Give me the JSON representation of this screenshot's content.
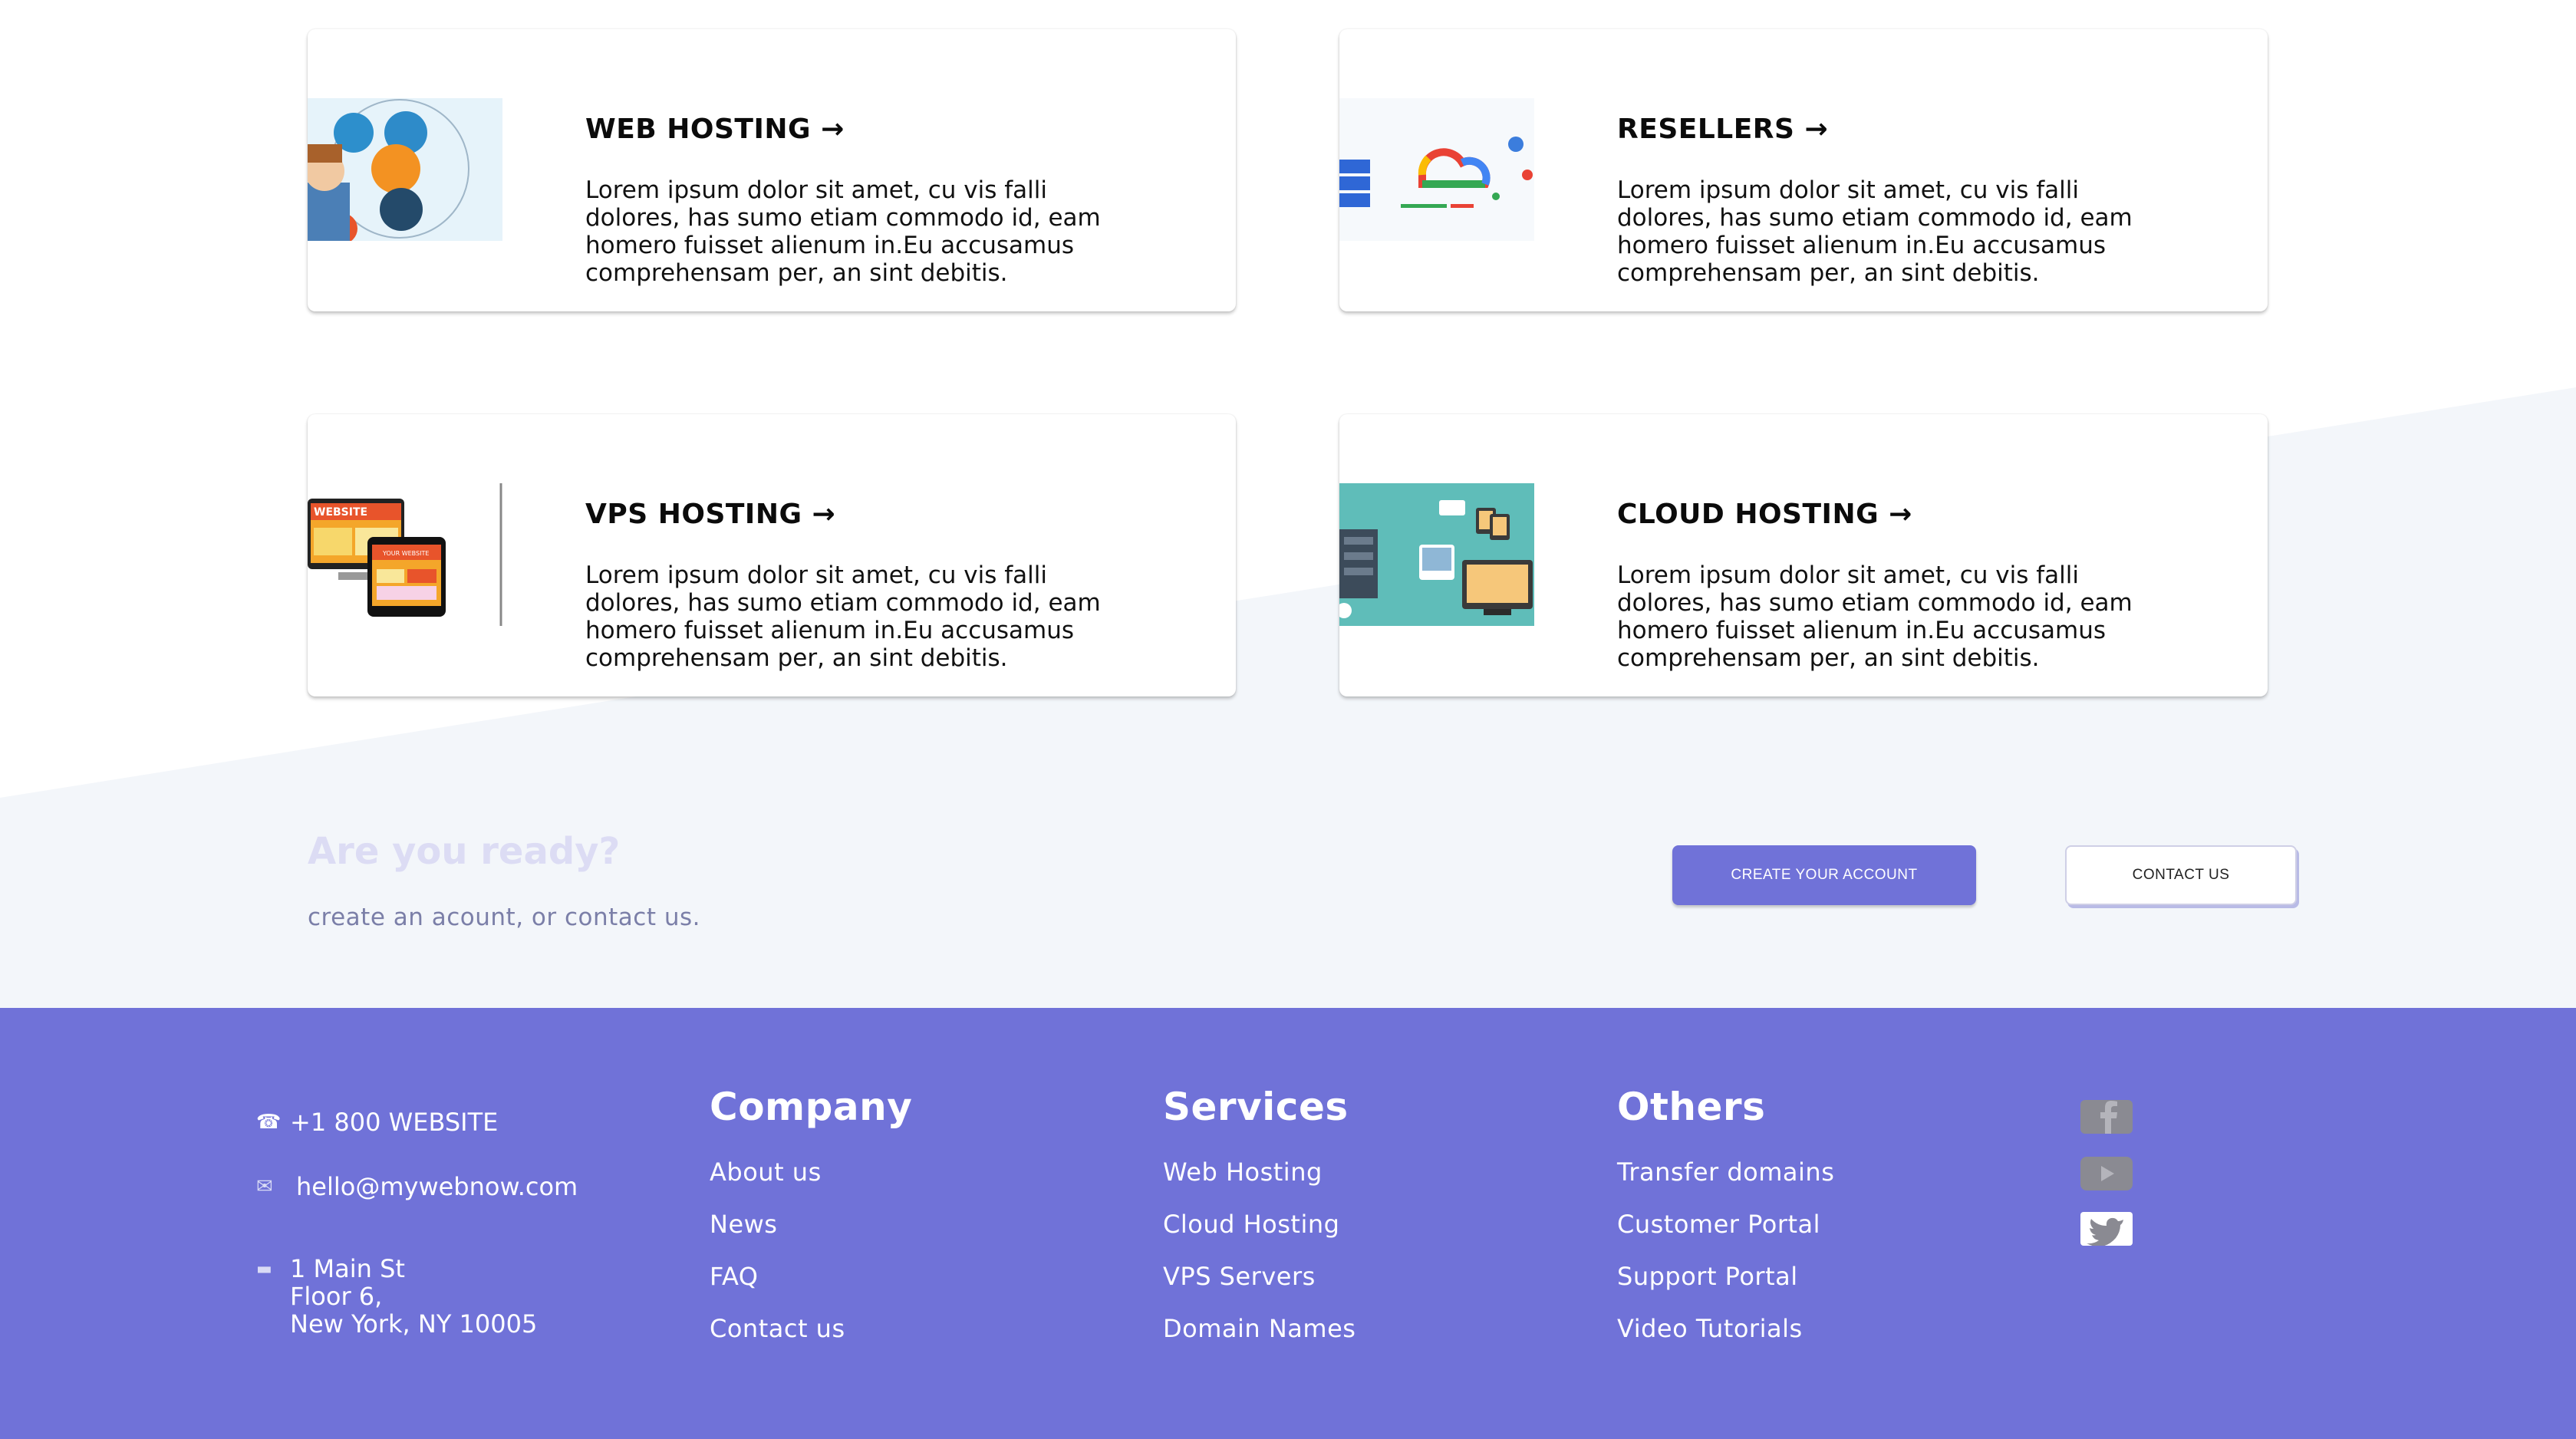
{
  "colors": {
    "brand": "#7072d8",
    "slant_bg": "#f3f6fa",
    "ready_title": "#dcdcf4",
    "ready_sub": "#7b7fa8"
  },
  "cards": [
    {
      "title": "WEB HOSTING →",
      "description": "Lorem ipsum dolor sit amet, cu vis falli dolores, has sumo etiam commodo id, eam homero fuisset alienum in.Eu accusamus comprehensam per, an sint debitis.",
      "image_icon": "web-hosting-illustration"
    },
    {
      "title": "RESELLERS →",
      "description": "Lorem ipsum dolor sit amet, cu vis falli dolores, has sumo etiam commodo id, eam homero fuisset alienum in.Eu accusamus comprehensam per, an sint debitis.",
      "image_icon": "cloud-servers-illustration"
    },
    {
      "title": "VPS HOSTING →",
      "description": "Lorem ipsum dolor sit amet, cu vis falli dolores, has sumo etiam commodo id, eam homero fuisset alienum in.Eu accusamus comprehensam per, an sint debitis.",
      "image_icon": "website-devices-illustration",
      "image_text_1": "WEBSITE",
      "image_text_2": "YOUR WEBSITE"
    },
    {
      "title": "CLOUD HOSTING →",
      "description": "Lorem ipsum dolor sit amet, cu vis falli dolores, has sumo etiam commodo id, eam homero fuisset alienum in.Eu accusamus comprehensam per, an sint debitis.",
      "image_icon": "cloud-network-illustration"
    }
  ],
  "cta": {
    "title": "Are you ready?",
    "subtitle": "create an acount, or contact us.",
    "primary_label": "CREATE YOUR ACCOUNT",
    "secondary_label": "CONTACT US"
  },
  "footer": {
    "phone": "+1 800 WEBSITE",
    "email": "hello@mywebnow.com",
    "address_lines": [
      "1 Main St",
      "Floor 6,",
      "New York, NY 10005"
    ],
    "columns": [
      {
        "heading": "Company",
        "links": [
          "About us",
          "News",
          "FAQ",
          "Contact us"
        ]
      },
      {
        "heading": "Services",
        "links": [
          "Web Hosting",
          "Cloud Hosting",
          "VPS Servers",
          "Domain Names"
        ]
      },
      {
        "heading": "Others",
        "links": [
          "Transfer domains",
          "Customer Portal",
          "Support Portal",
          "Video Tutorials"
        ]
      }
    ],
    "social": [
      "facebook-icon",
      "youtube-icon",
      "twitter-icon"
    ]
  }
}
